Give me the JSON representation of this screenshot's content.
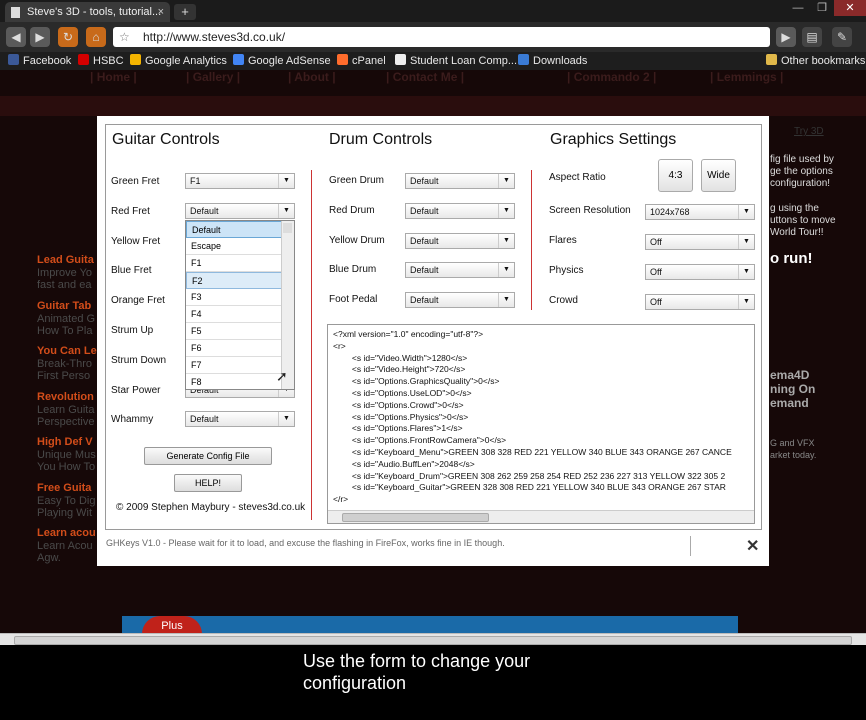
{
  "browser": {
    "tab_title": "Steve's 3D - tools, tutorial...",
    "tab_close": "×",
    "new_tab": "+",
    "url": "http://www.steves3d.co.uk/",
    "bookmarks": [
      {
        "label": "Facebook",
        "color": "#3b5998"
      },
      {
        "label": "HSBC",
        "color": "#d40000"
      },
      {
        "label": "Google Analytics",
        "color": "#f4b400"
      },
      {
        "label": "Google AdSense",
        "color": "#4285f4"
      },
      {
        "label": "cPanel",
        "color": "#ff6c2c"
      },
      {
        "label": "Student Loan Comp...",
        "color": "#eeeeee"
      },
      {
        "label": "Downloads",
        "color": "#3a7bd5"
      }
    ],
    "other_bookmarks": "Other bookmarks"
  },
  "site": {
    "nav": [
      "| Home |",
      "| Gallery |",
      "| About |",
      "| Contact Me |",
      "| Commando 2 |",
      "| Lemmings |"
    ],
    "side_links": [
      {
        "title": "Lead Guita",
        "lines": [
          "Improve Yo",
          "fast and ea"
        ]
      },
      {
        "title": "Guitar Tab",
        "lines": [
          "Animated G",
          "How To Pla"
        ]
      },
      {
        "title": "You Can Le",
        "lines": [
          "Break-Thro",
          "First Perso"
        ]
      },
      {
        "title": "Revolution",
        "lines": [
          "Learn Guita",
          "Perspective"
        ]
      },
      {
        "title": "High Def V",
        "lines": [
          "Unique Mus",
          "You How To"
        ]
      },
      {
        "title": "Free Guita",
        "lines": [
          "Easy To Dig",
          "Playing Wit"
        ]
      },
      {
        "title": "Learn acou",
        "lines": [
          "Learn Acou",
          "Agw."
        ]
      }
    ],
    "right_text": {
      "try3d": "Try 3D",
      "lines1": [
        "fig file used by",
        "ge the options",
        "configuration!"
      ],
      "lines2": [
        "g using the",
        "uttons to move",
        "World Tour!!"
      ],
      "run": "o run!",
      "lines3": [
        "ema4D",
        "ning On",
        "emand"
      ],
      "lines4": [
        "G and VFX",
        "arket today."
      ]
    },
    "plus": "Plus"
  },
  "dialog": {
    "guitar": {
      "title": "Guitar Controls",
      "rows": [
        {
          "label": "Green Fret",
          "value": "F1"
        },
        {
          "label": "Red Fret",
          "value": "Default"
        },
        {
          "label": "Yellow Fret",
          "value": ""
        },
        {
          "label": "Blue Fret",
          "value": ""
        },
        {
          "label": "Orange Fret",
          "value": ""
        },
        {
          "label": "Strum Up",
          "value": ""
        },
        {
          "label": "Strum Down",
          "value": ""
        },
        {
          "label": "Star Power",
          "value": "Default"
        },
        {
          "label": "Whammy",
          "value": "Default"
        }
      ],
      "dropdown_options": [
        "Default",
        "Escape",
        "F1",
        "F2",
        "F3",
        "F4",
        "F5",
        "F6",
        "F7",
        "F8"
      ],
      "generate_button": "Generate Config File",
      "help_button": "HELP!",
      "copyright": "© 2009 Stephen Maybury - steves3d.co.uk"
    },
    "drum": {
      "title": "Drum Controls",
      "rows": [
        {
          "label": "Green Drum",
          "value": "Default"
        },
        {
          "label": "Red Drum",
          "value": "Default"
        },
        {
          "label": "Yellow Drum",
          "value": "Default"
        },
        {
          "label": "Blue Drum",
          "value": "Default"
        },
        {
          "label": "Foot Pedal",
          "value": "Default"
        }
      ]
    },
    "graphics": {
      "title": "Graphics Settings",
      "aspect_label": "Aspect Ratio",
      "aspect_43": "4:3",
      "aspect_wide": "Wide",
      "rows": [
        {
          "label": "Screen Resolution",
          "value": "1024x768"
        },
        {
          "label": "Flares",
          "value": "Off"
        },
        {
          "label": "Physics",
          "value": "Off"
        },
        {
          "label": "Crowd",
          "value": "Off"
        }
      ]
    },
    "xml_lines": [
      "<?xml version=\"1.0\" encoding=\"utf-8\"?>",
      "<r>",
      "        <s id=\"Video.Width\">1280</s>",
      "        <s id=\"Video.Height\">720</s>",
      "        <s id=\"Options.GraphicsQuality\">0</s>",
      "        <s id=\"Options.UseLOD\">0</s>",
      "        <s id=\"Options.Crowd\">0</s>",
      "        <s id=\"Options.Physics\">0</s>",
      "        <s id=\"Options.Flares\">1</s>",
      "        <s id=\"Options.FrontRowCamera\">0</s>",
      "        <s id=\"Keyboard_Menu\">GREEN 308 328 RED 221 YELLOW 340 BLUE 343 ORANGE 267 CANCE",
      "        <s id=\"Audio.BuffLen\">2048</s>",
      "        <s id=\"Keyboard_Drum\">GREEN 308 262 259 258 254 RED 252 236 227 313 YELLOW 322 305 2",
      "        <s id=\"Keyboard_Guitar\">GREEN 328 308 RED 221 YELLOW 340 BLUE 343 ORANGE 267 STAR",
      "</r>"
    ],
    "status": "GHKeys V1.0 - Please wait for it to load, and excuse the flashing in FireFox, works fine in IE though.",
    "close": "✕"
  },
  "caption": {
    "line1": "Use the form to change your",
    "line2": "configuration"
  }
}
